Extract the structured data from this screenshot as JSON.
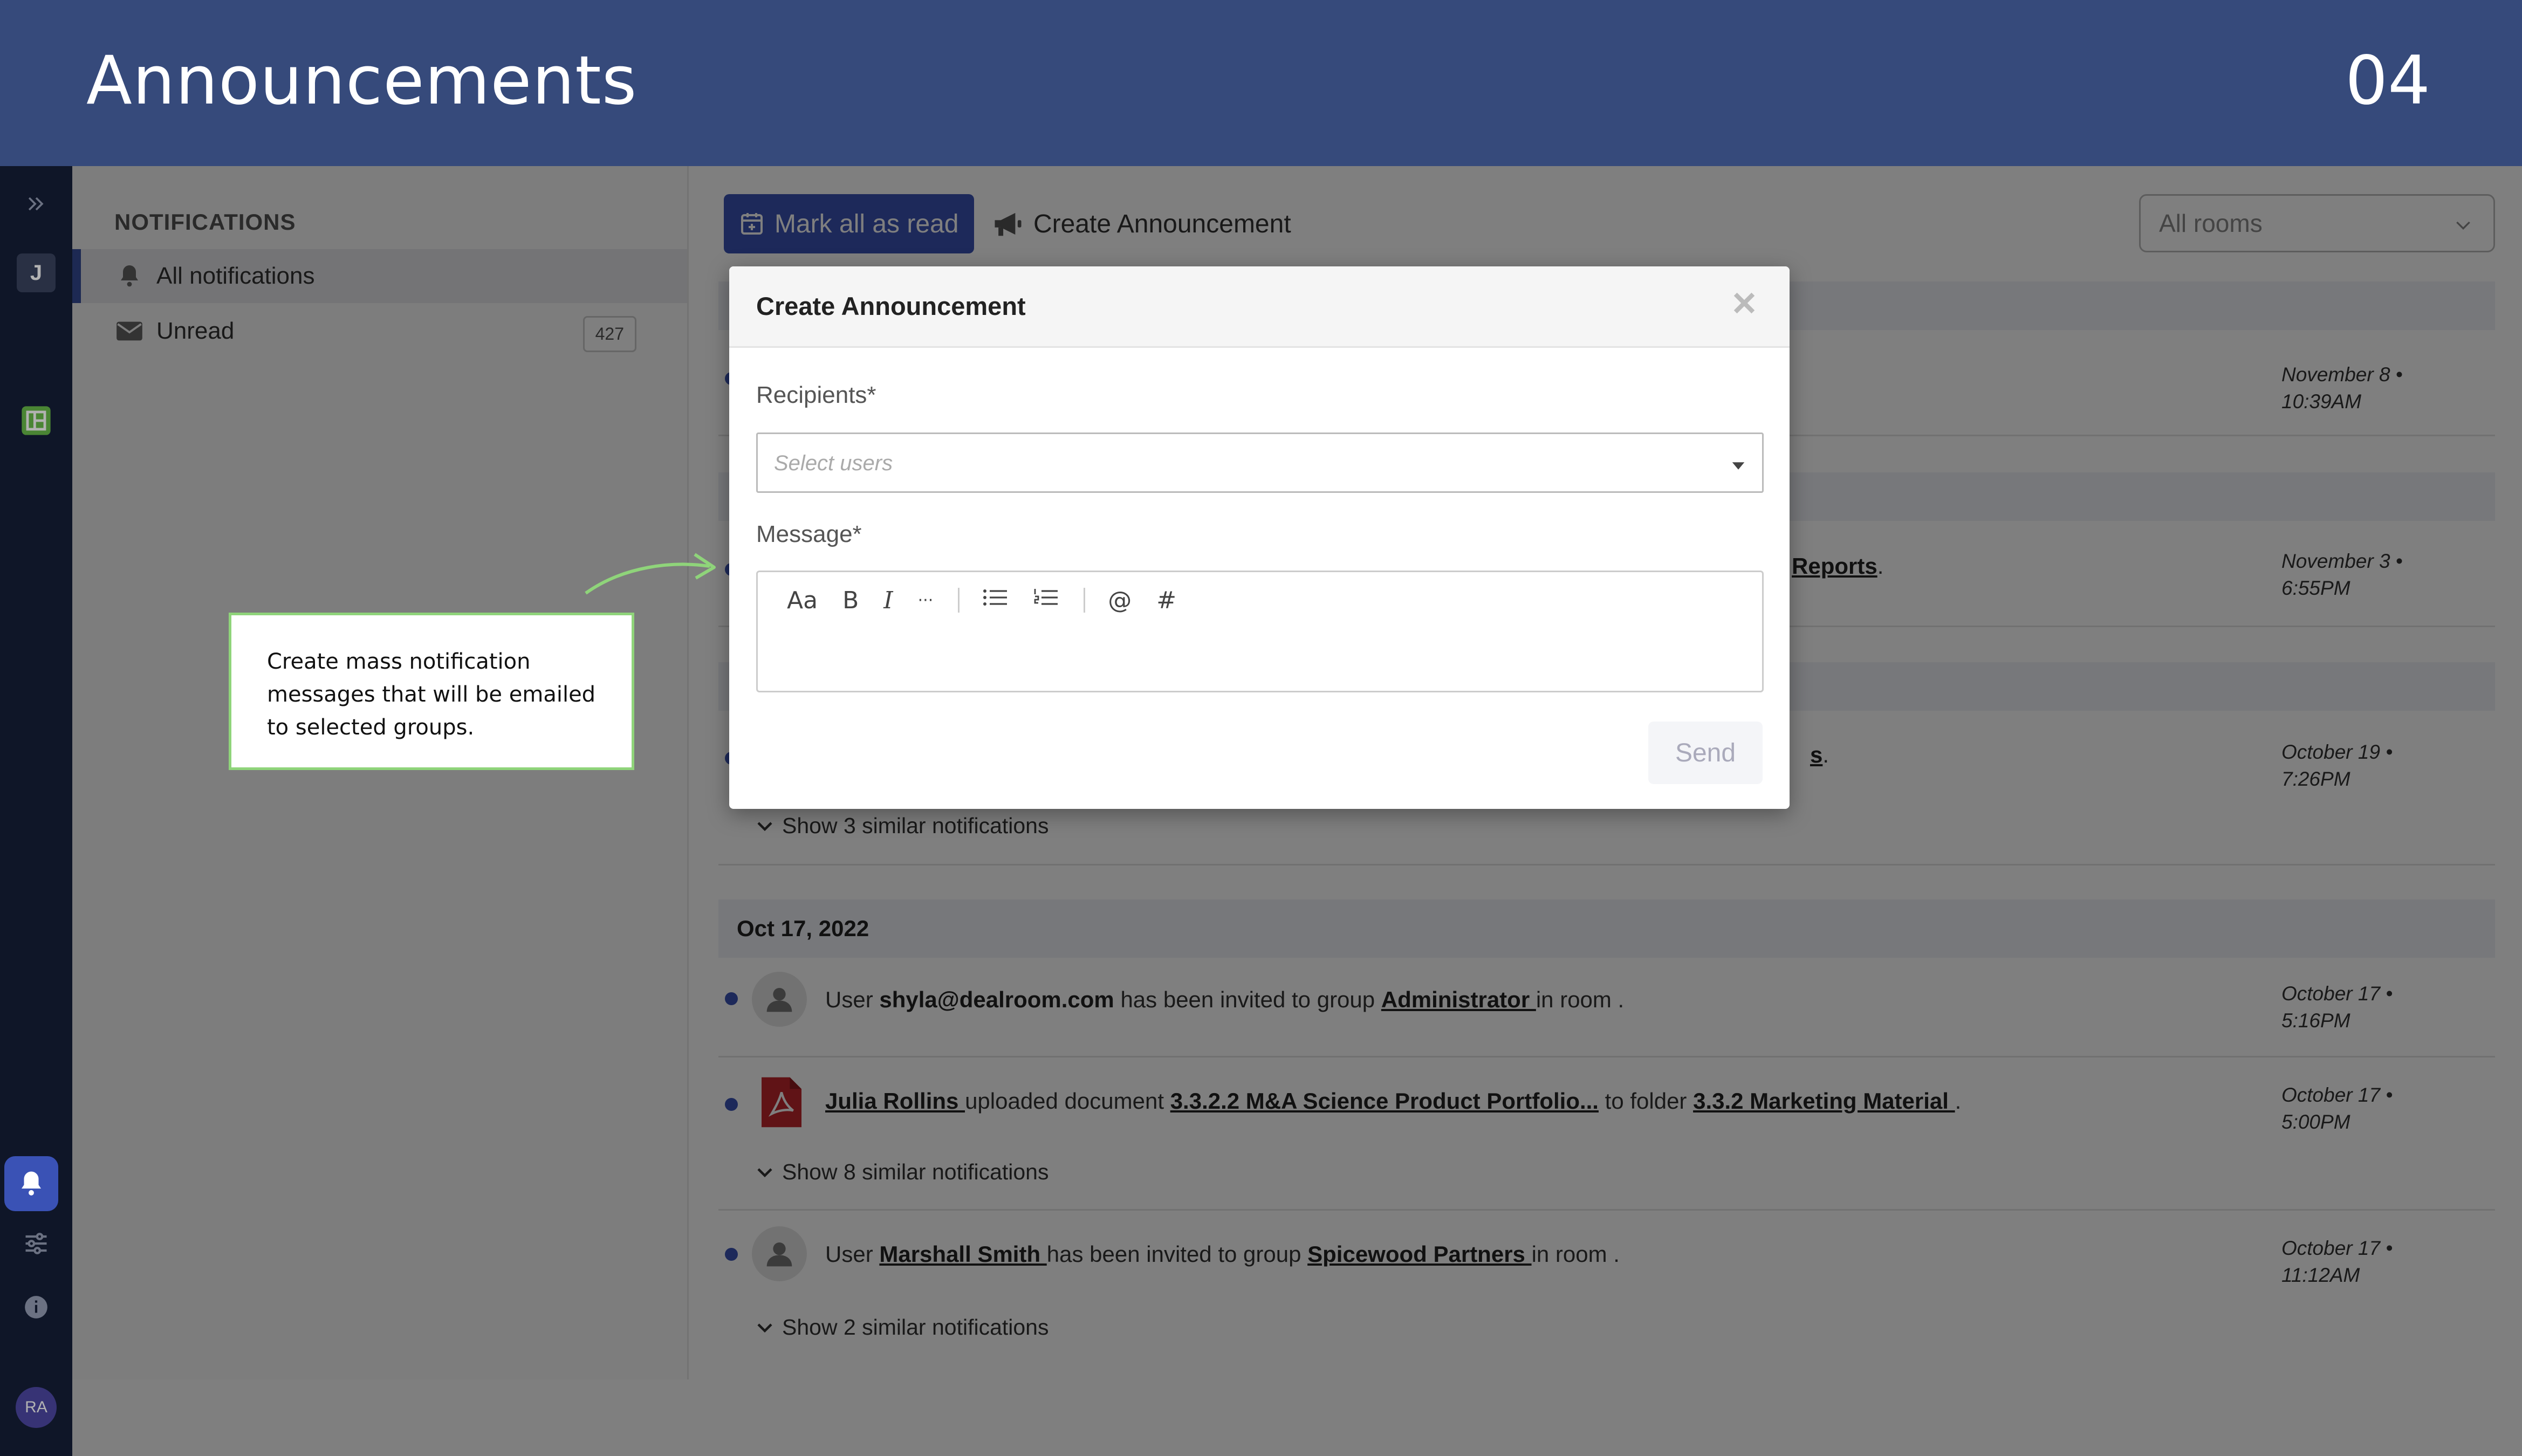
{
  "header": {
    "title": "Announcements",
    "slide_number": "04"
  },
  "rail": {
    "user_initial": "J",
    "avatar_initials": "RA",
    "icons": [
      "expand-icon",
      "workspace-icon",
      "bell-icon",
      "sliders-icon",
      "info-icon"
    ]
  },
  "sidebar": {
    "heading": "NOTIFICATIONS",
    "items": [
      {
        "label": "All notifications",
        "icon": "bell-icon"
      },
      {
        "label": "Unread",
        "icon": "envelope-icon",
        "count": "427"
      }
    ]
  },
  "toolbar": {
    "mark_all_label": "Mark all as read",
    "create_label": "Create Announcement",
    "rooms_filter": "All rooms"
  },
  "feed": {
    "partial_rows": [
      {
        "visible_text": "",
        "time_line1": "November 8 •",
        "time_line2": "10:39AM"
      },
      {
        "visible_text": "Reports",
        "tail": ".",
        "time_line1": "November 3 •",
        "time_line2": "6:55PM"
      },
      {
        "visible_text": "s",
        "tail": ".",
        "time_line1": "October 19 •",
        "time_line2": "7:26PM",
        "similar": "Show 3 similar notifications"
      }
    ],
    "date_group": "Oct 17, 2022",
    "rows": [
      {
        "p1": "User ",
        "bold": "shyla@dealroom.com",
        "p2": " has been invited to group ",
        "link": "Administrator ",
        "p3": " in room .",
        "time_line1": "October 17 •",
        "time_line2": "5:16PM"
      },
      {
        "link1": "Julia Rollins ",
        "p1": " uploaded document ",
        "link2": "3.3.2.2 M&A Science Product Portfolio...",
        "p2": " to folder ",
        "link3": "3.3.2 Marketing Material ",
        "p3": " .",
        "time_line1": "October 17 •",
        "time_line2": "5:00PM",
        "similar": "Show 8 similar notifications"
      },
      {
        "p1": "User ",
        "link1": "Marshall Smith ",
        "p2": " has been invited to group ",
        "link2": "Spicewood Partners ",
        "p3": " in room .",
        "time_line1": "October 17 •",
        "time_line2": "11:12AM",
        "similar": "Show 2 similar notifications"
      }
    ]
  },
  "modal": {
    "title": "Create Announcement",
    "recipients_label": "Recipients*",
    "recipients_placeholder": "Select users",
    "message_label": "Message*",
    "tools": [
      "Aa",
      "B",
      "I",
      "···",
      "bulleted-list-icon",
      "numbered-list-icon",
      "@",
      "#"
    ],
    "send_label": "Send"
  },
  "callout": {
    "text": "Create mass notification messages that will be emailed to selected groups."
  },
  "colors": {
    "header_bg": "#364a7b",
    "accent": "#3a52b5",
    "rail_bg": "#16203a",
    "callout_border": "#8fd47a"
  }
}
